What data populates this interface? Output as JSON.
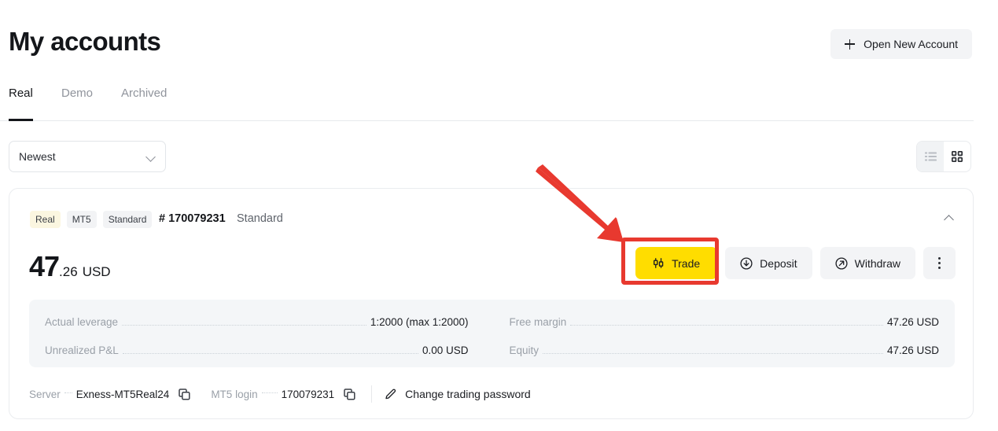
{
  "header": {
    "title": "My accounts",
    "open_account_label": "Open New Account",
    "plus_icon": "plus-icon"
  },
  "tabs": [
    {
      "label": "Real",
      "active": true
    },
    {
      "label": "Demo",
      "active": false
    },
    {
      "label": "Archived",
      "active": false
    }
  ],
  "toolbar": {
    "sort_value": "Newest",
    "sort_options": [
      "Newest"
    ],
    "chevron_icon": "chevron-down-icon",
    "view_list_icon": "list-view-icon",
    "view_grid_icon": "grid-view-icon",
    "view_active": "list"
  },
  "account": {
    "badges": [
      {
        "label": "Real",
        "kind": "real"
      },
      {
        "label": "MT5",
        "kind": "plain"
      },
      {
        "label": "Standard",
        "kind": "plain"
      }
    ],
    "number": "# 170079231",
    "type": "Standard",
    "collapse_icon": "chevron-up-icon",
    "balance": {
      "integer": "47",
      "decimal": ".26",
      "currency": "USD"
    },
    "actions": [
      {
        "label": "Trade",
        "icon": "candlestick-icon",
        "style": "primary"
      },
      {
        "label": "Deposit",
        "icon": "arrow-down-circle-icon",
        "style": "plain"
      },
      {
        "label": "Withdraw",
        "icon": "arrow-up-right-circle-icon",
        "style": "plain"
      },
      {
        "label": "",
        "icon": "kebab-menu-icon",
        "style": "kebab"
      }
    ],
    "stats": [
      {
        "label": "Actual leverage",
        "value": "1:2000 (max 1:2000)"
      },
      {
        "label": "Free margin",
        "value": "47.26 USD"
      },
      {
        "label": "Unrealized P&L",
        "value": "0.00 USD"
      },
      {
        "label": "Equity",
        "value": "47.26 USD"
      }
    ],
    "footer": {
      "server_label": "Server",
      "server_value": "Exness-MT5Real24",
      "login_label": "MT5 login",
      "login_value": "170079231",
      "copy_icon": "copy-icon",
      "change_password_label": "Change trading password",
      "pencil_icon": "pencil-icon"
    }
  },
  "annotation": {
    "arrow_color": "#e8392f",
    "box_color": "#e8392f",
    "arrow_icon": "red-arrow-pointer",
    "target": "Trade"
  },
  "colors": {
    "accent_yellow": "#ffdd00",
    "text_primary": "#14161a",
    "text_muted": "#9aa0a8",
    "panel_bg": "#f4f6f8",
    "button_bg": "#f3f4f6"
  }
}
